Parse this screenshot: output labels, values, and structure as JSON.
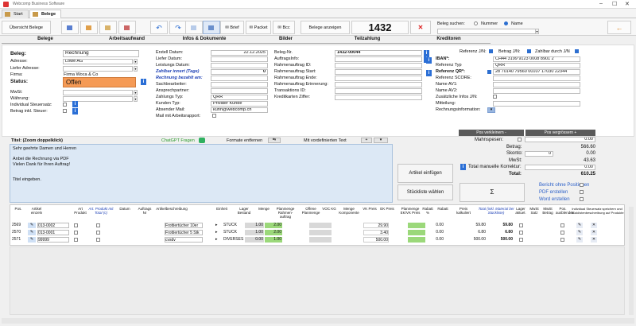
{
  "window": {
    "title": "Webcomp Business Software"
  },
  "tabs": [
    {
      "label": "Start"
    },
    {
      "label": "Belege"
    }
  ],
  "toolbar": {
    "overview": "Übersicht Belege",
    "brief": "Brief",
    "paket": "Packet",
    "bcc": "Bcc",
    "show": "Belege anzeigen",
    "number": "1432",
    "search_label": "Beleg suchen:",
    "radio_number": "Nummer",
    "radio_name": "Name"
  },
  "section_tabs": [
    "Belege",
    "Arbeitsaufwand",
    "Infos & Dokumente",
    "Bilder",
    "Teilzahlung",
    "Kreditoren"
  ],
  "left": {
    "beleg_label": "Beleg:",
    "beleg_value": "Rechnung",
    "adresse_label": "Adresse:",
    "adresse_value": "Löwe AG",
    "liefer_label": "Liefer Adresse:",
    "firma_label": "Firma:",
    "firma_value": "Firma Woca & Co",
    "status_label": "Status:",
    "status_value": "Offen",
    "mwst_label": "MwSt:",
    "waehrung_label": "Währung:",
    "ind_steuer_label": "Individual Steuersatz:",
    "betrag_inkl_label": "Betrag inkl. Steuer:"
  },
  "mid": {
    "erstell_label": "Erstell Datum:",
    "erstell_value": "22.12.2025",
    "liefer_label": "Liefer Datum:",
    "leistung_label": "Leistungs Datum:",
    "zahlbar_label": "Zahlbar innert (Tage)",
    "zahlbar_value": "0",
    "bezahlt_label": "Rechnung bezahlt am:",
    "sachbearbeiter_label": "Sachbearbeiter:",
    "ansprechpartner_label": "Ansprechpartner:",
    "zahlungs_typ_label": "Zahlungs Typ:",
    "zahlungs_typ_value": "QRR",
    "kunden_typ_label": "Kunden Typ:",
    "kunden_typ_value": "Privater Kunde",
    "absender_label": "Absender Mail:",
    "absender_value": "kuhn@webcomp.ch",
    "mail_arbeits_label": "Mail mit Arbeitsrapport:"
  },
  "right": {
    "beleg_nr_label": "Beleg-Nr.",
    "beleg_nr_value": "1432-00044",
    "auftrags_label": "AuftragsInfo:",
    "rahmen_id_label": "Rahmenauftrag ID:",
    "rahmen_start_label": "Rahmenauftrag Start:",
    "rahmen_ende_label": "Rahmenauftrag Ende:",
    "rahmen_erinn_label": "Rahmenauftrag Erinnerung:",
    "trans_id_label": "Transaktions ID:",
    "kredit_label": "Kreditkarten Ziffer:"
  },
  "far": {
    "ref_jn": "Referenz J/N:",
    "betrag_jn": "Betrag J/N:",
    "zahlbar_jn": "Zahlbar durch J/N",
    "iban_label": "IBAN*:",
    "iban_value": "CH44 3199 9123 0008 8901 2",
    "ref_typ_label": "Referenz Typ",
    "ref_typ_value": "QRR",
    "ref_qr_label": "Referenz QR*:",
    "ref_qr_value": "28 70140 79560 00107 17030 22344",
    "ref_score_label": "Referenz SCORE:",
    "name_av1": "Name AV1:",
    "name_av2": "Name AV2:",
    "zusatz_label": "Zusätzliche Infos J/N:",
    "mitteilung_label": "Mitteilung:",
    "rechnungsinfo_label": "Rechnungsinformation:"
  },
  "text": {
    "title_label": "Titel: (Zoom doppelklick)",
    "chatgpt": "ChatGPT Fragen",
    "formate": "Formate entfernen",
    "vordef": "Mit vordefinierten Text",
    "lines": [
      "Sehr geehrte Damen und Herren",
      "",
      "Anbei die Rechnung via PDF",
      "Vielen Dank für Ihren Auftrag!",
      "",
      "",
      "Titel eingeben."
    ]
  },
  "actions": {
    "artikel": "Artikel einfügen",
    "stueckliste": "Stückliste wählen",
    "sigma": "Σ"
  },
  "totals": {
    "pos_verkleinern": "Pos verkleinern -",
    "pos_vergroessern": "Pos vergrössern +",
    "mahnspesen_label": "Mahnspesen:",
    "mahnspesen_value": "0.00",
    "betrag_label": "Betrag:",
    "betrag_value": "566.60",
    "skonto_label": "Skonto:",
    "skonto_pct": "0",
    "skonto_value": "0.00",
    "mwst_label": "MwSt:",
    "mwst_value": "43.63",
    "manuelle_label": "Total manuelle Korrektur:",
    "manuelle_value": "0.00",
    "total_label": "Total:",
    "total_value": "610.25",
    "bericht": "Bericht ohne Positionen",
    "pdf": "PDF erstellen",
    "word": "Word erstellen"
  },
  "grid": {
    "headers": [
      "Pos.",
      "Artikel einzeln",
      "Art Produkt",
      "Art. Produkt mit Total (c)",
      "Datum",
      "Auftrags Nr",
      "Artikelbeschreibung",
      "Einheit",
      "Lager Bestand",
      "Menge",
      "Planmenge Rahmen-auftrag",
      "Offene Planmenge",
      "VOC KG",
      "Menge Komponente",
      "VK Preis",
      "EK Preis",
      "Planmenge EK/VK Preis",
      "Rabatt %",
      "Rabatt",
      "Preis kalkuliert",
      "Total (inkl. Material bei Stückliste)",
      "Lager aktuel.",
      "MwSt Satz",
      "MwSt Betrag",
      "Pos. ausblenden",
      "Individual Steuersatz speichern und Stücklistenbeschreibung auf Produkte"
    ],
    "rows": [
      {
        "pos": "2569",
        "art": "013-0002",
        "desc": "Frottiertücher 10er",
        "einheit": "STÜCK",
        "lager": "1.00",
        "menge": "2.00",
        "vk": "29.90",
        "rabattp": "0.00",
        "preis": "59.80",
        "total": "59.80"
      },
      {
        "pos": "2570",
        "art": "013-0001",
        "desc": "Frottiertücher 5 Stk",
        "einheit": "STÜCK",
        "lager": "1.00",
        "menge": "2.00",
        "vk": "3.40",
        "rabattp": "0.00",
        "preis": "6.80",
        "total": "6.80"
      },
      {
        "pos": "2571",
        "art": "99999",
        "desc": "cvsdv",
        "einheit": "DIVERSES",
        "lager": "0.00",
        "menge": "1.00",
        "vk": "500.00",
        "rabattp": "0.00",
        "preis": "500.00",
        "total": "500.00"
      }
    ]
  }
}
